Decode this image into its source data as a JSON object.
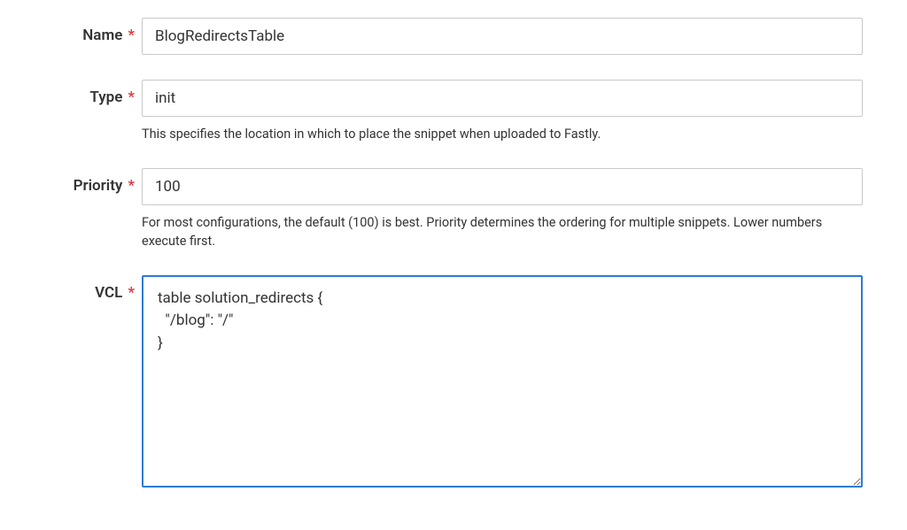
{
  "form": {
    "name": {
      "label": "Name",
      "value": "BlogRedirectsTable"
    },
    "type": {
      "label": "Type",
      "value": "init",
      "helper": "This specifies the location in which to place the snippet when uploaded to Fastly."
    },
    "priority": {
      "label": "Priority",
      "value": "100",
      "helper": "For most configurations, the default (100) is best. Priority determines the ordering for multiple snippets. Lower numbers execute first."
    },
    "vcl": {
      "label": "VCL",
      "value": "table solution_redirects {\n  \"/blog\": \"/\"\n}"
    },
    "required_marker": "*"
  }
}
